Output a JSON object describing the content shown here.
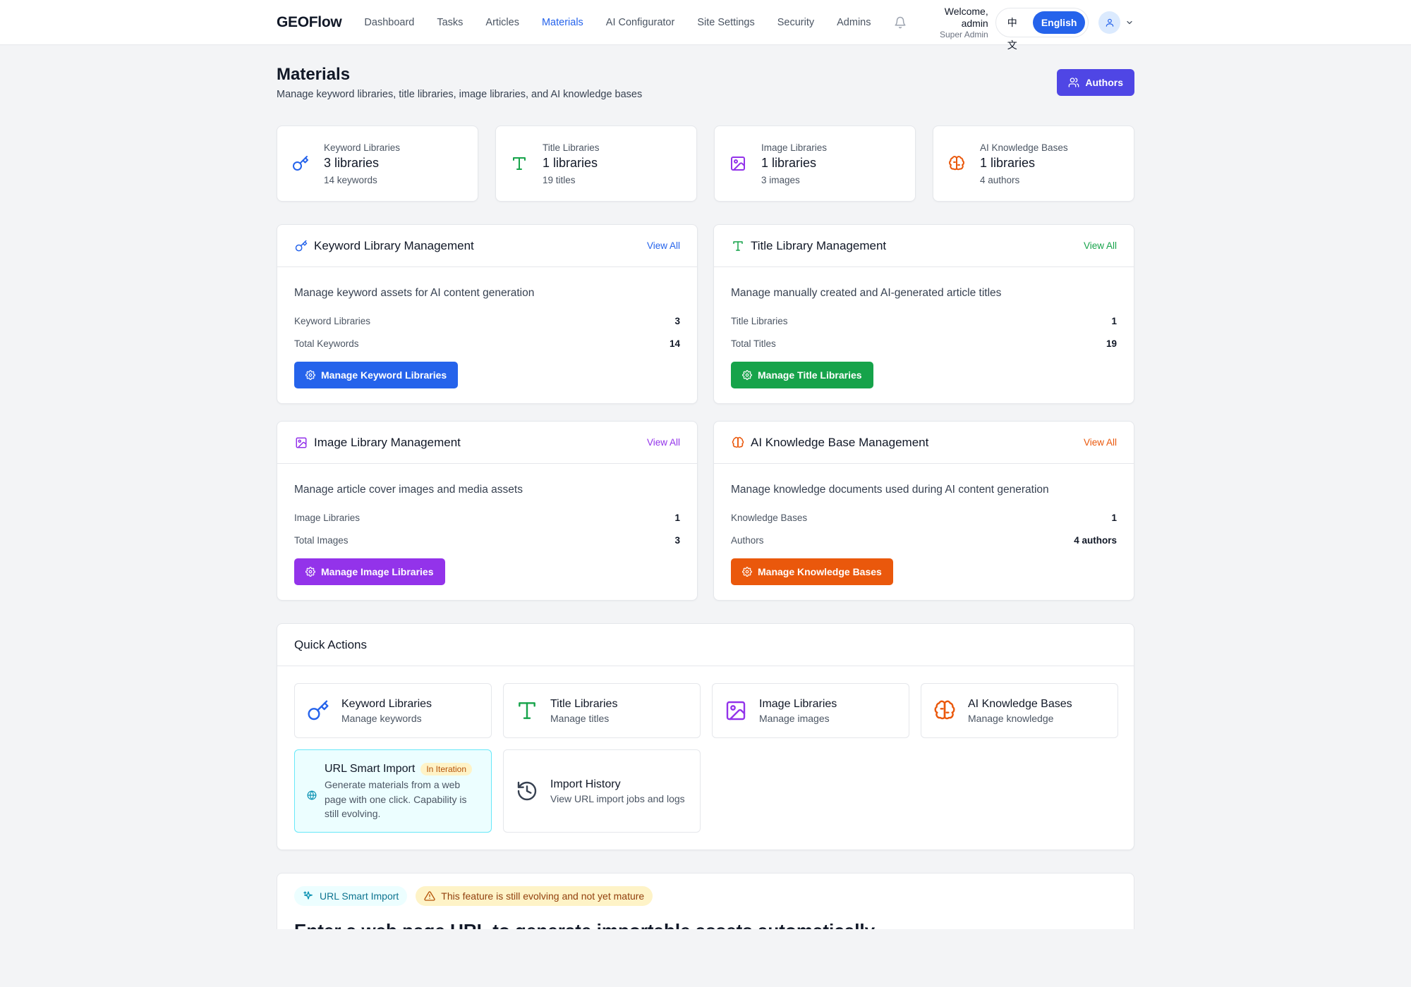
{
  "header": {
    "brand": "GEOFlow",
    "nav": [
      "Dashboard",
      "Tasks",
      "Articles",
      "Materials",
      "AI Configurator",
      "Site Settings",
      "Security",
      "Admins"
    ],
    "active_nav": "Materials",
    "welcome": "Welcome, admin",
    "role": "Super Admin",
    "lang_options": [
      "中文",
      "English"
    ],
    "lang_selected": "English"
  },
  "page": {
    "title": "Materials",
    "subtitle": "Manage keyword libraries, title libraries, image libraries, and AI knowledge bases",
    "authors_button": "Authors"
  },
  "colors": {
    "blue": "#2563eb",
    "green": "#16a34a",
    "purple": "#9333ea",
    "orange": "#ea580c",
    "indigo": "#4f46e5",
    "cyan": "#0891b2"
  },
  "stats": [
    {
      "label": "Keyword Libraries",
      "value": "3 libraries",
      "detail": "14 keywords",
      "icon": "key-icon"
    },
    {
      "label": "Title Libraries",
      "value": "1 libraries",
      "detail": "19 titles",
      "icon": "type-icon"
    },
    {
      "label": "Image Libraries",
      "value": "1 libraries",
      "detail": "3 images",
      "icon": "image-icon"
    },
    {
      "label": "AI Knowledge Bases",
      "value": "1 libraries",
      "detail": "4 authors",
      "icon": "brain-icon"
    }
  ],
  "panels": [
    {
      "title": "Keyword Library Management",
      "view_all": "View All",
      "desc": "Manage keyword assets for AI content generation",
      "rows": [
        {
          "label": "Keyword Libraries",
          "value": "3"
        },
        {
          "label": "Total Keywords",
          "value": "14"
        }
      ],
      "button": "Manage Keyword Libraries",
      "icon": "key-icon"
    },
    {
      "title": "Title Library Management",
      "view_all": "View All",
      "desc": "Manage manually created and AI-generated article titles",
      "rows": [
        {
          "label": "Title Libraries",
          "value": "1"
        },
        {
          "label": "Total Titles",
          "value": "19"
        }
      ],
      "button": "Manage Title Libraries",
      "icon": "type-icon"
    },
    {
      "title": "Image Library Management",
      "view_all": "View All",
      "desc": "Manage article cover images and media assets",
      "rows": [
        {
          "label": "Image Libraries",
          "value": "1"
        },
        {
          "label": "Total Images",
          "value": "3"
        }
      ],
      "button": "Manage Image Libraries",
      "icon": "image-icon"
    },
    {
      "title": "AI Knowledge Base Management",
      "view_all": "View All",
      "desc": "Manage knowledge documents used during AI content generation",
      "rows": [
        {
          "label": "Knowledge Bases",
          "value": "1"
        },
        {
          "label": "Authors",
          "value": "4 authors"
        }
      ],
      "button": "Manage Knowledge Bases",
      "icon": "brain-icon"
    }
  ],
  "quick_actions": {
    "title": "Quick Actions",
    "items": [
      {
        "title": "Keyword Libraries",
        "subtitle": "Manage keywords",
        "icon": "key-icon"
      },
      {
        "title": "Title Libraries",
        "subtitle": "Manage titles",
        "icon": "type-icon"
      },
      {
        "title": "Image Libraries",
        "subtitle": "Manage images",
        "icon": "image-icon"
      },
      {
        "title": "AI Knowledge Bases",
        "subtitle": "Manage knowledge",
        "icon": "brain-icon"
      },
      {
        "title": "URL Smart Import",
        "badge": "In Iteration",
        "subtitle": "Generate materials from a web page with one click. Capability is still evolving.",
        "icon": "globe-icon"
      },
      {
        "title": "Import History",
        "subtitle": "View URL import jobs and logs",
        "icon": "history-icon"
      }
    ]
  },
  "url_import": {
    "tag": "URL Smart Import",
    "warning": "This feature is still evolving and not yet mature",
    "heading": "Enter a web page URL to generate importable assets automatically"
  }
}
